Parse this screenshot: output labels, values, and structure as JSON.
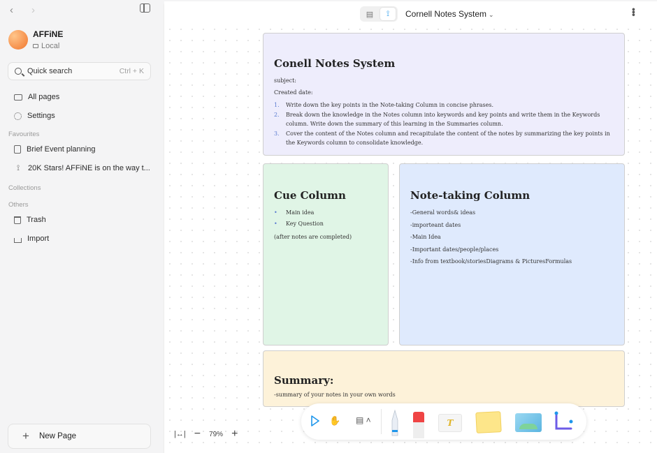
{
  "sidebar": {
    "nav_back": "‹",
    "nav_forward": "›",
    "workspace": {
      "name": "AFFiNE",
      "type": "Local"
    },
    "search": {
      "label": "Quick search",
      "shortcut": "Ctrl + K"
    },
    "all_pages": "All pages",
    "settings": "Settings",
    "favourites_label": "Favourites",
    "favourites": [
      {
        "label": "Brief Event planning",
        "icon": "page-icon"
      },
      {
        "label": "20K Stars! AFFiNE is on the way t...",
        "icon": "edgeless-icon"
      }
    ],
    "collections_label": "Collections",
    "others_label": "Others",
    "trash": "Trash",
    "import": "Import",
    "new_page": "New Page"
  },
  "header": {
    "doc_title": "Cornell Notes System",
    "mode_active": "edgeless",
    "accent_color": "#1e96eb"
  },
  "canvas": {
    "header_note": {
      "title": "Conell Notes System",
      "subject": "subject:",
      "created": "Created date:",
      "steps": [
        {
          "num": "1.",
          "text": "Write down the key points in the Note-taking Column in concise phrases."
        },
        {
          "num": "2.",
          "text": "Break down the knowledge in the Notes column into keywords and key points and write them in the Keywords column. Write down the summary of this learning in the Summaries column."
        },
        {
          "num": "3.",
          "text": "Cover the content of the Notes column and recapitulate the content of the notes by summarizing the key points in the Keywords column to consolidate knowledge."
        }
      ]
    },
    "cue_note": {
      "title": "Cue Column",
      "bullets": [
        "Main idea",
        "Key Question"
      ],
      "footer": "(after notes are completed)"
    },
    "notetaking_note": {
      "title": "Note-taking Column",
      "lines": [
        "-General  words& ideas",
        "-importeant dates",
        "-Main Idea",
        "-Important dates/people/places",
        "-Info from textbook/storiesDiagrams & PicturesFormulas"
      ]
    },
    "summary_note": {
      "title": "Summary:",
      "text": "-summary of your notes in your own words"
    }
  },
  "zoom": {
    "value": "79%",
    "minus": "−",
    "plus": "+"
  },
  "toolbar": {
    "text_tool_glyph": "T",
    "colors": {
      "pen": "#1e96eb",
      "marker": "#ef4444",
      "sticky": "#fde68a",
      "connector": "#6d5ce7"
    }
  }
}
